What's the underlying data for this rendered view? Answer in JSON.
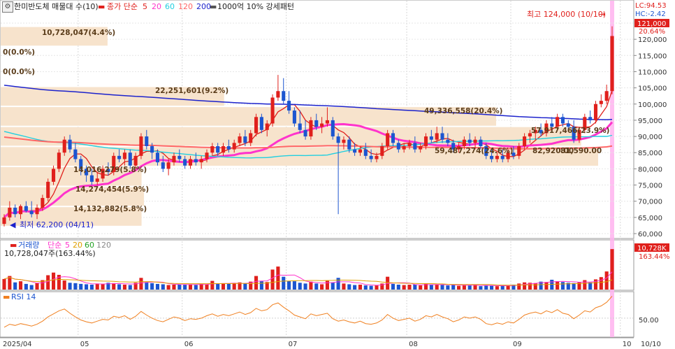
{
  "header": {
    "stock_name": "한미반도체 매물대 수(10)",
    "ma_label": "종가 단순",
    "ma_periods": [
      "5",
      "20",
      "60",
      "120",
      "200"
    ],
    "ma_colors": [
      "#e0201c",
      "#ff33cc",
      "#22cfe0",
      "#ff6666",
      "#1c22cc"
    ],
    "condition": "1000억 10% 강세패턴",
    "settings_icon": "gear-icon"
  },
  "price_axis": {
    "ticks": [
      "125,000",
      "120,000",
      "115,000",
      "110,000",
      "105,000",
      "100,000",
      "95,000",
      "90,000",
      "85,000",
      "80,000",
      "75,000",
      "70,000",
      "65,000",
      "60,000"
    ],
    "lc_label": "LC:94.53",
    "hc_label": "HC:-2.42",
    "current_price_label": "121,000",
    "current_change_label": "20.64%"
  },
  "high_marker": "최고 124,000 (10/10)",
  "low_marker": "최저 62,200 (04/11)",
  "volume_profile_labels": [
    "10,728,047(4.4%)",
    "0(0.0%)",
    "0(0.0%)",
    "22,251,601(9.2%)",
    "49,336,558(20.4%)",
    "57,917,466(23.9%)",
    "59,487,274(24.6%)",
    "14,016,279(5.8%)",
    "14,274,454(5.9%)",
    "14,132,882(5.8%)"
  ],
  "mid_note_a": "82,920.00",
  "mid_note_b": "81,590.00",
  "volume_panel": {
    "title": "거래량",
    "ma_label": "단순",
    "ma_periods": [
      "5",
      "20",
      "60",
      "120"
    ],
    "ma_colors": [
      "#ff33cc",
      "#e0a000",
      "#22a022",
      "#888888"
    ],
    "current_volume_text": "10,728,047주(163.44%)",
    "axis_badge": "10,728K",
    "axis_pct": "163.44%"
  },
  "rsi_panel": {
    "title": "RSI 14",
    "tick": "50.00"
  },
  "x_axis": {
    "labels": [
      "2025/04",
      "05",
      "06",
      "07",
      "08",
      "09",
      "10",
      "10/10"
    ]
  },
  "colors": {
    "up": "#e0201c",
    "down": "#1c55d0",
    "profile": "#f7e3cc",
    "highlight": "#ffb3ee",
    "rsi": "#f08020"
  },
  "chart_data": {
    "type": "candlestick",
    "x_labels": [
      "2025/04",
      "05",
      "06",
      "07",
      "08",
      "09",
      "10"
    ],
    "month_start_index": [
      0,
      14,
      33,
      52,
      74,
      93,
      113
    ],
    "price_ylim": [
      60000,
      125000
    ],
    "ohlc": [
      [
        63000,
        66000,
        62200,
        65000
      ],
      [
        65000,
        70000,
        64000,
        68000
      ],
      [
        68000,
        69000,
        65000,
        66000
      ],
      [
        66000,
        69000,
        64500,
        68500
      ],
      [
        68500,
        70000,
        66500,
        67000
      ],
      [
        67000,
        70000,
        65000,
        66000
      ],
      [
        66000,
        69000,
        64500,
        68000
      ],
      [
        68000,
        72000,
        67000,
        71000
      ],
      [
        71000,
        77000,
        70000,
        76000
      ],
      [
        76000,
        81000,
        75000,
        80000
      ],
      [
        80000,
        86000,
        79000,
        85000
      ],
      [
        85000,
        90000,
        84000,
        89000
      ],
      [
        89000,
        90500,
        85000,
        86000
      ],
      [
        86000,
        88000,
        82000,
        83000
      ],
      [
        83000,
        84000,
        78000,
        80000
      ],
      [
        80000,
        81000,
        76000,
        78000
      ],
      [
        78000,
        80000,
        75000,
        76000
      ],
      [
        76000,
        79000,
        75000,
        77000
      ],
      [
        77000,
        81000,
        76000,
        80000
      ],
      [
        80000,
        82000,
        78000,
        79000
      ],
      [
        79000,
        85000,
        78000,
        84000
      ],
      [
        84000,
        86000,
        82000,
        83000
      ],
      [
        83000,
        86000,
        81000,
        85000
      ],
      [
        85000,
        86000,
        80000,
        81000
      ],
      [
        81000,
        85000,
        80000,
        84000
      ],
      [
        84000,
        91000,
        83000,
        90000
      ],
      [
        90000,
        92000,
        86000,
        87000
      ],
      [
        87000,
        88000,
        83000,
        85000
      ],
      [
        85000,
        86000,
        81000,
        82000
      ],
      [
        82000,
        84000,
        79000,
        80000
      ],
      [
        80000,
        83000,
        78000,
        82000
      ],
      [
        82000,
        85000,
        81000,
        84000
      ],
      [
        84000,
        86000,
        82000,
        83000
      ],
      [
        83000,
        84000,
        80000,
        81000
      ],
      [
        81000,
        84000,
        80000,
        83000
      ],
      [
        83000,
        85000,
        81000,
        82000
      ],
      [
        82000,
        84000,
        80000,
        83000
      ],
      [
        83000,
        86000,
        82000,
        85000
      ],
      [
        85000,
        88000,
        84000,
        87000
      ],
      [
        87000,
        88000,
        84000,
        85000
      ],
      [
        85000,
        88000,
        84000,
        87000
      ],
      [
        87000,
        89000,
        85000,
        86000
      ],
      [
        86000,
        89000,
        85000,
        88000
      ],
      [
        88000,
        91000,
        87000,
        90000
      ],
      [
        90000,
        92000,
        87000,
        88000
      ],
      [
        88000,
        92000,
        87000,
        91000
      ],
      [
        91000,
        97000,
        90000,
        96000
      ],
      [
        96000,
        97000,
        91000,
        92000
      ],
      [
        92000,
        95000,
        90000,
        94000
      ],
      [
        94000,
        103000,
        93000,
        102000
      ],
      [
        102000,
        109000,
        101000,
        104000
      ],
      [
        104000,
        108000,
        100000,
        101000
      ],
      [
        101000,
        104000,
        97000,
        98000
      ],
      [
        98000,
        99000,
        93000,
        94000
      ],
      [
        94000,
        98000,
        91000,
        92000
      ],
      [
        92000,
        95000,
        89000,
        90000
      ],
      [
        90000,
        96000,
        89000,
        95000
      ],
      [
        95000,
        97000,
        92000,
        93000
      ],
      [
        93000,
        96000,
        91000,
        94000
      ],
      [
        94000,
        99000,
        93000,
        95000
      ],
      [
        95000,
        96000,
        89000,
        90000
      ],
      [
        90000,
        91000,
        66000,
        88000
      ],
      [
        88000,
        90000,
        86000,
        89000
      ],
      [
        89000,
        90000,
        85000,
        86000
      ],
      [
        86000,
        88000,
        84000,
        85000
      ],
      [
        85000,
        87000,
        84000,
        86000
      ],
      [
        86000,
        88000,
        83000,
        84000
      ],
      [
        84000,
        86000,
        82000,
        83000
      ],
      [
        83000,
        85000,
        82000,
        84000
      ],
      [
        84000,
        88000,
        83000,
        87000
      ],
      [
        87000,
        92000,
        86000,
        91000
      ],
      [
        91000,
        92000,
        87000,
        88000
      ],
      [
        88000,
        89000,
        85000,
        86000
      ],
      [
        86000,
        88000,
        85000,
        87000
      ],
      [
        87000,
        89000,
        86000,
        88000
      ],
      [
        88000,
        90000,
        85000,
        86000
      ],
      [
        86000,
        88000,
        85000,
        87000
      ],
      [
        87000,
        91000,
        86000,
        90000
      ],
      [
        90000,
        92000,
        88000,
        89000
      ],
      [
        89000,
        93000,
        88000,
        91000
      ],
      [
        91000,
        93000,
        88000,
        89000
      ],
      [
        89000,
        91000,
        87000,
        88000
      ],
      [
        88000,
        89000,
        85000,
        86000
      ],
      [
        86000,
        88000,
        85000,
        87000
      ],
      [
        87000,
        90000,
        86000,
        89000
      ],
      [
        89000,
        91000,
        87000,
        88000
      ],
      [
        88000,
        90000,
        86000,
        89000
      ],
      [
        89000,
        90000,
        86000,
        87000
      ],
      [
        87000,
        88000,
        83000,
        84000
      ],
      [
        84000,
        86000,
        82000,
        83000
      ],
      [
        83000,
        85000,
        82000,
        84000
      ],
      [
        84000,
        86000,
        82000,
        83000
      ],
      [
        83000,
        86000,
        82000,
        85000
      ],
      [
        85000,
        87000,
        83000,
        84000
      ],
      [
        84000,
        88000,
        83000,
        87000
      ],
      [
        87000,
        91000,
        86000,
        90000
      ],
      [
        90000,
        92000,
        88000,
        91000
      ],
      [
        91000,
        93000,
        89000,
        92000
      ],
      [
        92000,
        94000,
        90000,
        91000
      ],
      [
        91000,
        95000,
        90000,
        94000
      ],
      [
        94000,
        96000,
        92000,
        93000
      ],
      [
        93000,
        97000,
        92000,
        96000
      ],
      [
        96000,
        97000,
        93000,
        94000
      ],
      [
        94000,
        95000,
        92000,
        93000
      ],
      [
        93000,
        95000,
        88000,
        89000
      ],
      [
        89000,
        93000,
        88000,
        92000
      ],
      [
        92000,
        97000,
        91000,
        96000
      ],
      [
        96000,
        98000,
        94000,
        95000
      ],
      [
        95000,
        101000,
        94000,
        100000
      ],
      [
        100000,
        103000,
        99000,
        101000
      ],
      [
        101000,
        106000,
        100000,
        104000
      ],
      [
        104000,
        124000,
        103000,
        121000
      ]
    ],
    "volume_ylim": [
      0,
      11500000
    ],
    "volume": [
      2800000,
      3600000,
      1900000,
      2200000,
      1500000,
      1200000,
      1700000,
      2500000,
      3800000,
      4500000,
      3900000,
      2400000,
      1800000,
      1700000,
      1500000,
      1400000,
      1300000,
      1600000,
      1500000,
      1800000,
      1700000,
      1400000,
      1300000,
      1200000,
      1800000,
      3100000,
      2000000,
      1700000,
      1500000,
      1400000,
      1200000,
      1300000,
      1400000,
      1300000,
      1400000,
      1200000,
      1500000,
      1300000,
      2300000,
      1500000,
      1600000,
      1500000,
      1700000,
      1900000,
      1600000,
      2100000,
      3600000,
      2200000,
      2000000,
      5300000,
      6100000,
      3400000,
      2300000,
      2200000,
      1800000,
      1600000,
      2100000,
      1600000,
      1400000,
      2300000,
      1900000,
      3100000,
      1600000,
      1400000,
      1200000,
      1300000,
      1100000,
      1000000,
      1100000,
      1600000,
      3400000,
      1500000,
      1300000,
      1200000,
      1300000,
      1300000,
      1100000,
      1600000,
      1200000,
      1400000,
      1200000,
      1100000,
      1300000,
      1000000,
      1200000,
      1100000,
      1300000,
      900000,
      1100000,
      1000000,
      900000,
      1100000,
      1000000,
      1300000,
      1600000,
      1900000,
      1800000,
      1700000,
      2100000,
      2000000,
      2600000,
      2200000,
      2000000,
      1800000,
      1700000,
      2000000,
      2500000,
      1900000,
      2700000,
      3300000,
      4800000,
      10728047
    ],
    "rsi_ylim": [
      20,
      90
    ],
    "rsi": [
      35,
      40,
      38,
      41,
      39,
      37,
      40,
      45,
      52,
      57,
      62,
      65,
      58,
      52,
      47,
      44,
      42,
      45,
      48,
      47,
      53,
      51,
      54,
      48,
      53,
      61,
      55,
      50,
      46,
      44,
      48,
      52,
      50,
      46,
      49,
      48,
      50,
      54,
      57,
      53,
      56,
      54,
      57,
      60,
      56,
      59,
      66,
      62,
      64,
      72,
      75,
      68,
      62,
      55,
      52,
      49,
      57,
      54,
      56,
      58,
      49,
      45,
      47,
      44,
      42,
      45,
      41,
      40,
      42,
      47,
      56,
      50,
      46,
      48,
      50,
      45,
      48,
      54,
      52,
      56,
      52,
      49,
      44,
      47,
      52,
      50,
      52,
      48,
      41,
      39,
      42,
      40,
      44,
      42,
      48,
      55,
      58,
      60,
      57,
      62,
      59,
      64,
      58,
      56,
      49,
      55,
      62,
      60,
      67,
      70,
      76,
      86
    ],
    "volume_profile_pct": [
      4.4,
      0.0,
      0.0,
      9.2,
      20.4,
      23.9,
      24.6,
      5.8,
      5.9,
      5.8
    ]
  }
}
